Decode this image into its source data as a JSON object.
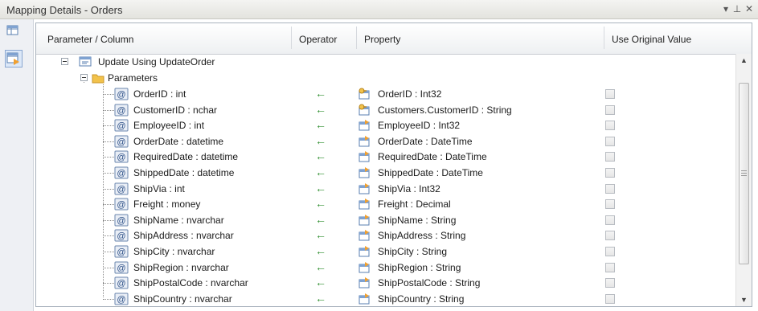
{
  "window": {
    "title": "Mapping Details - Orders",
    "dropdown_glyph": "▾",
    "pin_glyph": "⊥",
    "close_glyph": "✕"
  },
  "columns": {
    "parameter": "Parameter / Column",
    "operator": "Operator",
    "property": "Property",
    "use_original": "Use Original Value"
  },
  "tree": {
    "function_label": "Update Using UpdateOrder",
    "group_label": "Parameters"
  },
  "rows": [
    {
      "param": "OrderID : int",
      "operator": "←",
      "property": "OrderID : Int32",
      "key": true,
      "use_original": false
    },
    {
      "param": "CustomerID : nchar",
      "operator": "←",
      "property": "Customers.CustomerID : String",
      "key": true,
      "use_original": false
    },
    {
      "param": "EmployeeID : int",
      "operator": "←",
      "property": "EmployeeID : Int32",
      "key": false,
      "use_original": false
    },
    {
      "param": "OrderDate : datetime",
      "operator": "←",
      "property": "OrderDate : DateTime",
      "key": false,
      "use_original": false
    },
    {
      "param": "RequiredDate : datetime",
      "operator": "←",
      "property": "RequiredDate : DateTime",
      "key": false,
      "use_original": false
    },
    {
      "param": "ShippedDate : datetime",
      "operator": "←",
      "property": "ShippedDate : DateTime",
      "key": false,
      "use_original": false
    },
    {
      "param": "ShipVia : int",
      "operator": "←",
      "property": "ShipVia : Int32",
      "key": false,
      "use_original": false
    },
    {
      "param": "Freight : money",
      "operator": "←",
      "property": "Freight : Decimal",
      "key": false,
      "use_original": false
    },
    {
      "param": "ShipName : nvarchar",
      "operator": "←",
      "property": "ShipName : String",
      "key": false,
      "use_original": false
    },
    {
      "param": "ShipAddress : nvarchar",
      "operator": "←",
      "property": "ShipAddress : String",
      "key": false,
      "use_original": false
    },
    {
      "param": "ShipCity : nvarchar",
      "operator": "←",
      "property": "ShipCity : String",
      "key": false,
      "use_original": false
    },
    {
      "param": "ShipRegion : nvarchar",
      "operator": "←",
      "property": "ShipRegion : String",
      "key": false,
      "use_original": false
    },
    {
      "param": "ShipPostalCode : nvarchar",
      "operator": "←",
      "property": "ShipPostalCode : String",
      "key": false,
      "use_original": false
    },
    {
      "param": "ShipCountry : nvarchar",
      "operator": "←",
      "property": "ShipCountry : String",
      "key": false,
      "use_original": false
    }
  ],
  "icons": {
    "param": "parameter-icon",
    "prop": "property-icon",
    "key_prop": "key-property-icon",
    "function": "function-icon",
    "folder": "folder-icon"
  },
  "colors": {
    "arrow": "#2f8f2f",
    "folder": "#f2c24b",
    "accent": "#3b6fb6"
  }
}
